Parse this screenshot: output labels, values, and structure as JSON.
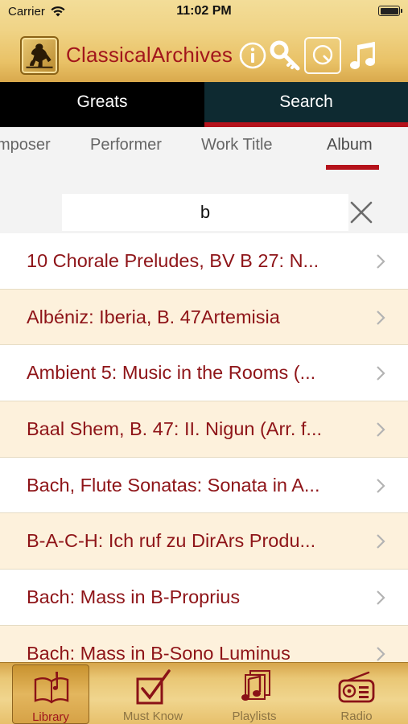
{
  "status_bar": {
    "carrier": "Carrier",
    "time": "11:02 PM"
  },
  "nav": {
    "title": "ClassicalArchives",
    "icons": [
      "logo-icon",
      "info-icon",
      "key-icon",
      "search-icon",
      "music-note-icon"
    ]
  },
  "segments": {
    "greats": "Greats",
    "search": "Search",
    "selected": "search"
  },
  "categories": {
    "composer": "mposer",
    "performer": "Performer",
    "work_title": "Work Title",
    "album": "Album",
    "selected": "album"
  },
  "search": {
    "value": "b",
    "clear_icon": "close-icon"
  },
  "results": [
    {
      "title": "10 Chorale Preludes, BV B 27: N..."
    },
    {
      "title": "Albéniz: Iberia, B. 47Artemisia"
    },
    {
      "title": "Ambient 5: Music in the Rooms (..."
    },
    {
      "title": "Baal Shem, B. 47: II. Nigun (Arr. f..."
    },
    {
      "title": "Bach, Flute Sonatas: Sonata in A..."
    },
    {
      "title": "B-A-C-H: Ich ruf zu DirArs Produ..."
    },
    {
      "title": "Bach: Mass in B-Proprius"
    },
    {
      "title": "Bach: Mass in B-Sono Luminus"
    }
  ],
  "tabbar": {
    "library": "Library",
    "must_know": "Must Know",
    "playlists": "Playlists",
    "radio": "Radio",
    "selected": "library"
  },
  "colors": {
    "accent_red": "#b5121b",
    "text_red": "#8e1418",
    "gold": "#f0d487",
    "row_alt": "#fdf1dc",
    "segment_dark": "#0e2a31"
  }
}
